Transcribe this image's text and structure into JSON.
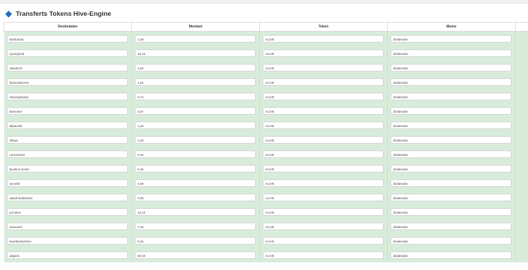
{
  "page": {
    "title": "Transferts Tokens Hive-Engine",
    "title_icon": "diamond-icon",
    "accent_color": "#1f6fbf",
    "row_color": "#d9ecdc"
  },
  "table": {
    "columns": [
      "Destinataire",
      "Montant",
      "Token",
      "Memo"
    ],
    "rows": [
      {
        "to": "bambukah",
        "amount": "1,49",
        "token": "ALIVE",
        "memo": "dividendes"
      },
      {
        "to": "synergized",
        "amount": "10,16",
        "token": "ALIVE",
        "memo": "dividendes"
      },
      {
        "to": "clavdio75",
        "amount": "2,66",
        "token": "ALIVE",
        "memo": "dividendes"
      },
      {
        "to": "florensaboeris",
        "amount": "1,64",
        "token": "ALIVE",
        "memo": "dividendes"
      },
      {
        "to": "ieksenpahdya",
        "amount": "0,74",
        "token": "ALIVE",
        "memo": "dividendes"
      },
      {
        "to": "beeminer",
        "amount": "0,67",
        "token": "ALIVE",
        "memo": "dividendes"
      },
      {
        "to": "albator65",
        "amount": "1,26",
        "token": "ALIVE",
        "memo": "dividendes"
      },
      {
        "to": "elkaaz",
        "amount": "0,18",
        "token": "ALIVE",
        "memo": "dividendes"
      },
      {
        "to": "c3r24n103r",
        "amount": "0,15",
        "token": "ALIVE",
        "memo": "dividendes"
      },
      {
        "to": "faustine.books",
        "amount": "0,46",
        "token": "ALIVE",
        "memo": "dividendes"
      },
      {
        "to": "servelle",
        "amount": "4,69",
        "token": "ALIVE",
        "memo": "dividendes"
      },
      {
        "to": "satoshinakam0to",
        "amount": "0,05",
        "token": "ALIVE",
        "memo": "dividendes"
      },
      {
        "to": "pof.alive",
        "amount": "10,23",
        "token": "ALIVE",
        "memo": "dividendes"
      },
      {
        "to": "manuvert",
        "amount": "7,45",
        "token": "ALIVE",
        "memo": "dividendes"
      },
      {
        "to": "heartbeatonhive",
        "amount": "0,15",
        "token": "ALIVE",
        "memo": "dividendes"
      },
      {
        "to": "adgaris",
        "amount": "50,64",
        "token": "ALIVE",
        "memo": "dividendes"
      }
    ]
  }
}
